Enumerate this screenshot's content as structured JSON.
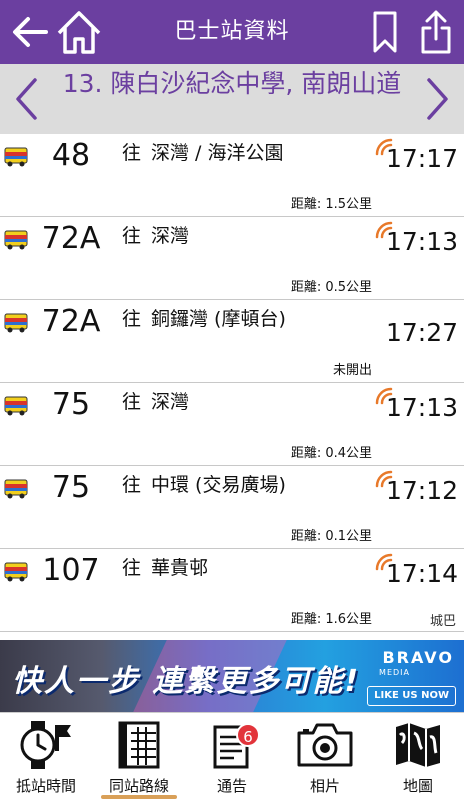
{
  "header": {
    "title": "巴士站資料"
  },
  "stop": {
    "name": "13. 陳白沙紀念中學, 南朗山道"
  },
  "accent_colors": {
    "header": "#6b3fa0",
    "eta_signal": "#e8792a",
    "badge": "#e2343b",
    "active_tab": "#d9a058"
  },
  "routes": [
    {
      "route": "48",
      "direction_prefix": "往",
      "destination": "深灣 / 海洋公園",
      "eta": "17:17",
      "note": "距離: 1.5公里",
      "sub": "",
      "live": true
    },
    {
      "route": "72A",
      "direction_prefix": "往",
      "destination": "深灣",
      "eta": "17:13",
      "note": "距離: 0.5公里",
      "sub": "",
      "live": true
    },
    {
      "route": "72A",
      "direction_prefix": "往",
      "destination": "銅鑼灣 (摩頓台)",
      "eta": "17:27",
      "note": "未開出",
      "sub": "",
      "live": false
    },
    {
      "route": "75",
      "direction_prefix": "往",
      "destination": "深灣",
      "eta": "17:13",
      "note": "距離: 0.4公里",
      "sub": "",
      "live": true
    },
    {
      "route": "75",
      "direction_prefix": "往",
      "destination": "中環 (交易廣場)",
      "eta": "17:12",
      "note": "距離: 0.1公里",
      "sub": "",
      "live": true
    },
    {
      "route": "107",
      "direction_prefix": "往",
      "destination": "華貴邨",
      "eta": "17:14",
      "note": "距離: 1.6公里",
      "sub": "城巴",
      "live": true
    }
  ],
  "ad": {
    "headline": "快人一步 連繫更多可能!",
    "brand": "BRAVO",
    "brand_sub": "MEDIA",
    "cta": "LIKE US NOW"
  },
  "tabs": [
    {
      "label": "抵站時間",
      "icon": "watch-clock-icon",
      "active": false
    },
    {
      "label": "同站路線",
      "icon": "grid-table-icon",
      "active": true
    },
    {
      "label": "通告",
      "icon": "notice-document-icon",
      "active": false,
      "badge": "6"
    },
    {
      "label": "相片",
      "icon": "camera-icon",
      "active": false
    },
    {
      "label": "地圖",
      "icon": "map-icon",
      "active": false
    }
  ],
  "icons": {
    "back": "back-arrow-icon",
    "home": "home-icon",
    "bookmark": "bookmark-icon",
    "share": "share-icon",
    "prev": "chevron-left-icon",
    "next": "chevron-right-icon",
    "bus": "bus-icon",
    "signal": "signal-icon"
  }
}
